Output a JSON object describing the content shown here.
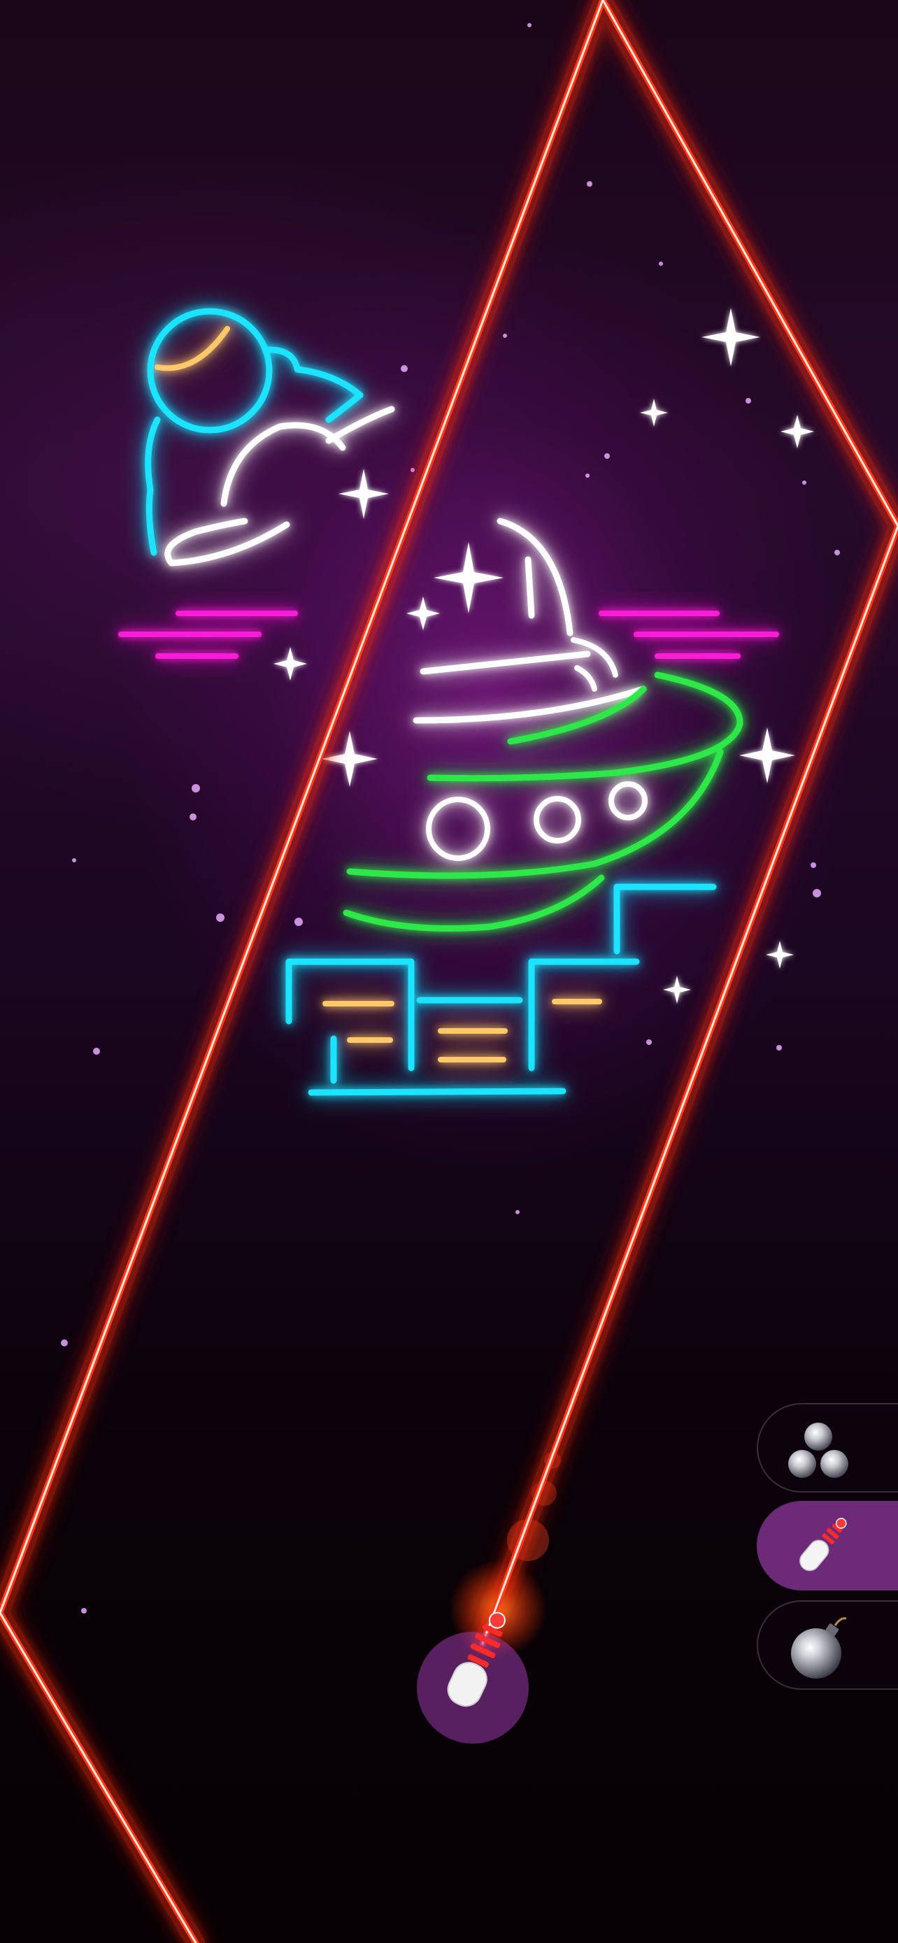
{
  "scene": {
    "background_color": "#1a0618",
    "wall_color": "#ff3a1a",
    "neon_colors": {
      "cyan": "#1ee3ff",
      "white": "#ffffff",
      "gold": "#ffc86a",
      "magenta": "#ff1ed8",
      "green": "#2ee84a",
      "purple_glow": "#c83ce0"
    },
    "neon_sign": {
      "depicts": [
        "astronaut-surfing",
        "ufo-spaceship",
        "city-buildings",
        "sparkle-stars"
      ]
    }
  },
  "toolbar": {
    "items": [
      {
        "name": "multiball",
        "icon": "three-balls-icon",
        "selected": false
      },
      {
        "name": "launcher",
        "icon": "launcher-plunger-icon",
        "selected": true
      },
      {
        "name": "bomb",
        "icon": "bomb-icon",
        "selected": false
      }
    ],
    "selected_color": "#6c2a78"
  },
  "player": {
    "launcher_icon": "launcher-plunger-icon",
    "glow_color": "#ff7a1a"
  }
}
